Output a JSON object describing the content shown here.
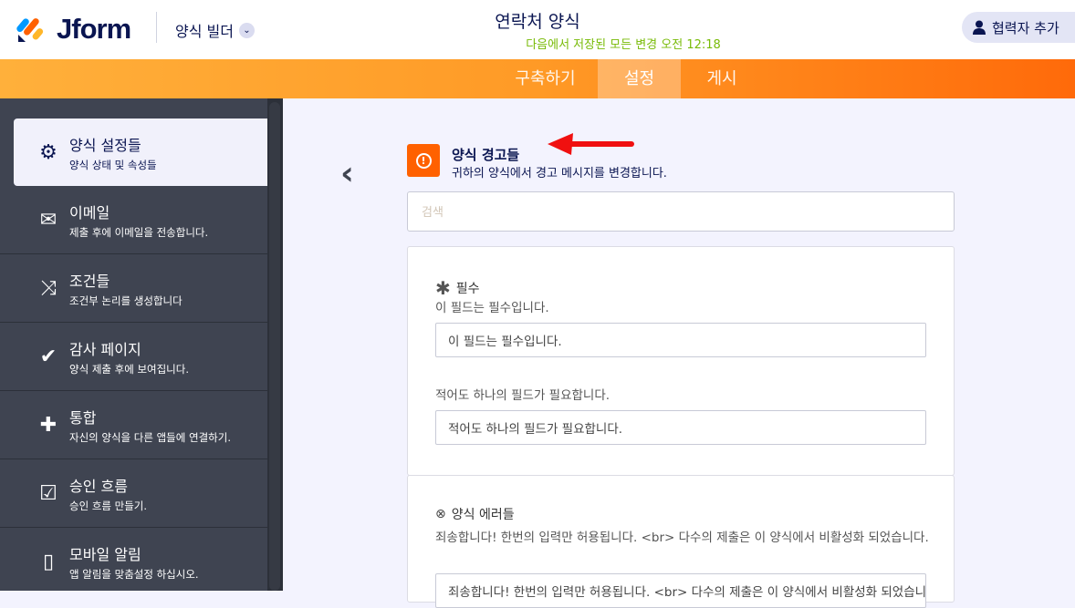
{
  "header": {
    "logo": "Jform",
    "builder_label": "양식 빌더",
    "form_title": "연락처 양식",
    "saved_status": "다음에서 저장된 모든 변경 오전 12:18",
    "collab_button": "협력자 추가"
  },
  "tabs": [
    {
      "label": "구축하기"
    },
    {
      "label": "설정",
      "active": true
    },
    {
      "label": "게시"
    }
  ],
  "sidebar": {
    "items": [
      {
        "title": "양식 설정들",
        "subtitle": "양식 상태 및 속성들",
        "icon": "gear-icon"
      },
      {
        "title": "이메일",
        "subtitle": "제출 후에 이메일을 전송합니다.",
        "icon": "envelope-icon"
      },
      {
        "title": "조건들",
        "subtitle": "조건부 논리를 생성합니다",
        "icon": "shuffle-icon"
      },
      {
        "title": "감사 페이지",
        "subtitle": "양식 제출 후에 보여집니다.",
        "icon": "check-circle-icon"
      },
      {
        "title": "통합",
        "subtitle": "자신의 양식을 다른 앱들에 연결하기.",
        "icon": "puzzle-icon"
      },
      {
        "title": "승인 흐름",
        "subtitle": "승인 흐름 만들기.",
        "icon": "approval-icon"
      },
      {
        "title": "모바일 알림",
        "subtitle": "앱 알림을 맞춤설정 하십시오.",
        "icon": "mobile-icon"
      }
    ]
  },
  "main": {
    "title": "양식 경고들",
    "description": "귀하의 양식에서 경고 메시지를 변경합니다.",
    "search_placeholder": "검색",
    "required": {
      "label": "필수",
      "desc1": "이 필드는 필수입니다.",
      "value1": "이 필드는 필수입니다.",
      "desc2": "적어도 하나의 필드가 필요합니다.",
      "value2": "적어도 하나의 필드가 필요합니다."
    },
    "errors": {
      "label": "양식 에러들",
      "desc": "죄송합니다! 한번의 입력만 허용됩니다. <br> 다수의 제출은 이 양식에서 비활성화 되었습니다.",
      "value": "죄송합니다! 한번의 입력만 허용됩니다. <br> 다수의 제출은 이 양식에서 비활성화 되었습니다."
    }
  },
  "colors": {
    "accent": "#ff6100",
    "sidebar": "#3f4451",
    "saved": "#78bb07"
  }
}
